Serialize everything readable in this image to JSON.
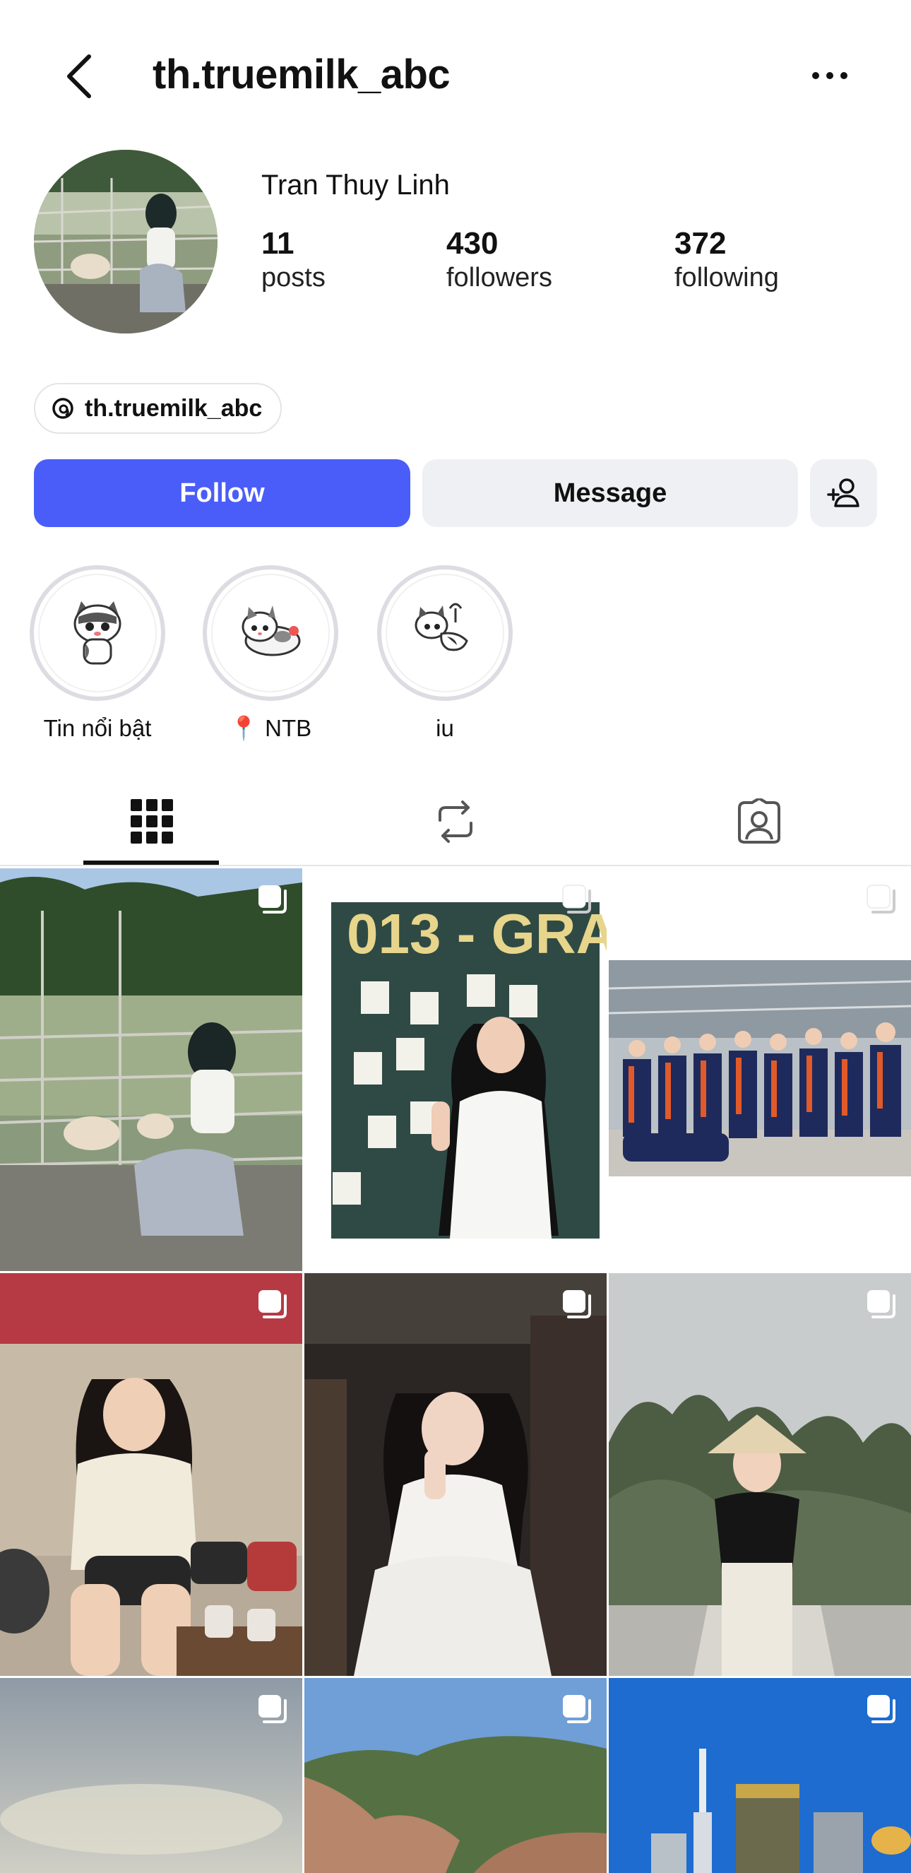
{
  "header": {
    "username": "th.truemilk_abc"
  },
  "profile": {
    "full_name": "Tran Thuy Linh",
    "stats": {
      "posts_count": "11",
      "posts_label": "posts",
      "followers_count": "430",
      "followers_label": "followers",
      "following_count": "372",
      "following_label": "following"
    },
    "threads_handle": "th.truemilk_abc"
  },
  "actions": {
    "follow_label": "Follow",
    "message_label": "Message"
  },
  "highlights": [
    {
      "label": "Tin nổi bật"
    },
    {
      "label": "📍 NTB"
    },
    {
      "label": "iu"
    }
  ],
  "tabs": [
    {
      "icon": "grid-icon",
      "active": true
    },
    {
      "icon": "reposts-icon",
      "active": false
    },
    {
      "icon": "tagged-icon",
      "active": false
    }
  ],
  "posts": [
    {
      "desc": "girl with goats at fence",
      "multi": true
    },
    {
      "desc": "graduation chalkboard",
      "multi": true
    },
    {
      "desc": "group graduation photo",
      "multi": true
    },
    {
      "desc": "girl seated cafe",
      "multi": true
    },
    {
      "desc": "girl in white dress",
      "multi": true
    },
    {
      "desc": "girl with conical hat",
      "multi": true
    },
    {
      "desc": "sky",
      "multi": true
    },
    {
      "desc": "rocky coast",
      "multi": true
    },
    {
      "desc": "city towers",
      "multi": true
    }
  ],
  "colors": {
    "follow_bg": "#4a5df9",
    "secondary_bg": "#eff0f3",
    "highlight_ring": "#dcdde2"
  }
}
